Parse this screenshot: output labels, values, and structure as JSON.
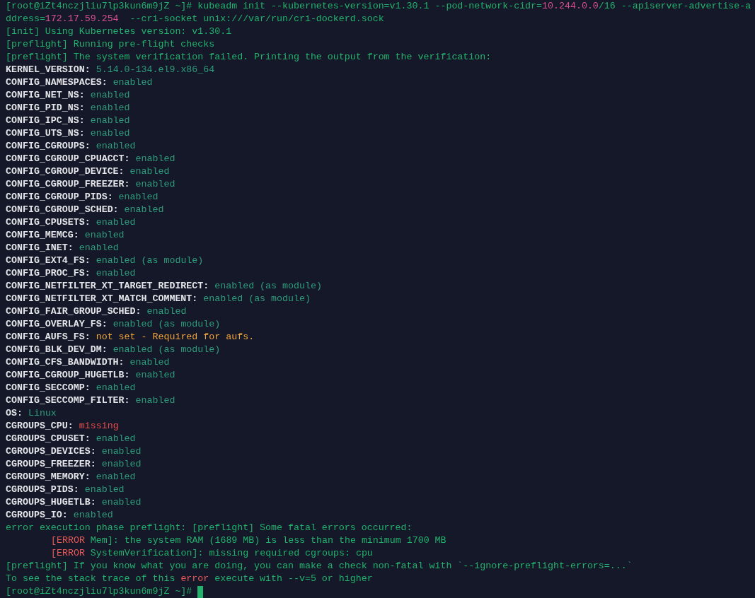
{
  "terminal": {
    "lines": [
      {
        "kind": "text",
        "segments": [
          {
            "kind": "plain",
            "text": "[root@iZt4nczjliu7lp3kun6m9jZ ~]# kubeadm init --kubernetes-version=v1.30.1 --pod-network-cidr="
          },
          {
            "kind": "number",
            "text": "10.244.0.0"
          },
          {
            "kind": "plain",
            "text": "/16 --apiserver-advertise-a"
          }
        ]
      },
      {
        "kind": "text",
        "segments": [
          {
            "kind": "plain",
            "text": "ddress="
          },
          {
            "kind": "number",
            "text": "172.17.59.254"
          },
          {
            "kind": "plain",
            "text": "  --cri-socket unix:///var/run/cri-dockerd.sock"
          }
        ]
      },
      {
        "kind": "text",
        "segments": [
          {
            "kind": "plain",
            "text": "[init] Using Kubernetes version: v1.30.1"
          }
        ]
      },
      {
        "kind": "text",
        "segments": [
          {
            "kind": "plain",
            "text": "[preflight] Running pre-flight checks"
          }
        ]
      },
      {
        "kind": "text",
        "segments": [
          {
            "kind": "plain",
            "text": "[preflight] The system verification failed. Printing the output from the verification:"
          }
        ]
      },
      {
        "kind": "check",
        "key": "KERNEL_VERSION:",
        "value": "5.14.0-134.el9.x86_64",
        "color": "#2e9c7c"
      },
      {
        "kind": "check",
        "key": "CONFIG_NAMESPACES:",
        "value": "enabled",
        "color": "#2e9c7c"
      },
      {
        "kind": "check",
        "key": "CONFIG_NET_NS:",
        "value": "enabled",
        "color": "#2e9c7c"
      },
      {
        "kind": "check",
        "key": "CONFIG_PID_NS:",
        "value": "enabled",
        "color": "#2e9c7c"
      },
      {
        "kind": "check",
        "key": "CONFIG_IPC_NS:",
        "value": "enabled",
        "color": "#2e9c7c"
      },
      {
        "kind": "check",
        "key": "CONFIG_UTS_NS:",
        "value": "enabled",
        "color": "#2e9c7c"
      },
      {
        "kind": "check",
        "key": "CONFIG_CGROUPS:",
        "value": "enabled",
        "color": "#2e9c7c"
      },
      {
        "kind": "check",
        "key": "CONFIG_CGROUP_CPUACCT:",
        "value": "enabled",
        "color": "#2e9c7c"
      },
      {
        "kind": "check",
        "key": "CONFIG_CGROUP_DEVICE:",
        "value": "enabled",
        "color": "#2e9c7c"
      },
      {
        "kind": "check",
        "key": "CONFIG_CGROUP_FREEZER:",
        "value": "enabled",
        "color": "#2e9c7c"
      },
      {
        "kind": "check",
        "key": "CONFIG_CGROUP_PIDS:",
        "value": "enabled",
        "color": "#2e9c7c"
      },
      {
        "kind": "check",
        "key": "CONFIG_CGROUP_SCHED:",
        "value": "enabled",
        "color": "#2e9c7c"
      },
      {
        "kind": "check",
        "key": "CONFIG_CPUSETS:",
        "value": "enabled",
        "color": "#2e9c7c"
      },
      {
        "kind": "check",
        "key": "CONFIG_MEMCG:",
        "value": "enabled",
        "color": "#2e9c7c"
      },
      {
        "kind": "check",
        "key": "CONFIG_INET:",
        "value": "enabled",
        "color": "#2e9c7c"
      },
      {
        "kind": "check",
        "key": "CONFIG_EXT4_FS:",
        "value": "enabled (as module)",
        "color": "#2e9c7c"
      },
      {
        "kind": "check",
        "key": "CONFIG_PROC_FS:",
        "value": "enabled",
        "color": "#2e9c7c"
      },
      {
        "kind": "check",
        "key": "CONFIG_NETFILTER_XT_TARGET_REDIRECT:",
        "value": "enabled (as module)",
        "color": "#2e9c7c"
      },
      {
        "kind": "check",
        "key": "CONFIG_NETFILTER_XT_MATCH_COMMENT:",
        "value": "enabled (as module)",
        "color": "#2e9c7c"
      },
      {
        "kind": "check",
        "key": "CONFIG_FAIR_GROUP_SCHED:",
        "value": "enabled",
        "color": "#2e9c7c"
      },
      {
        "kind": "check",
        "key": "CONFIG_OVERLAY_FS:",
        "value": "enabled (as module)",
        "color": "#2e9c7c"
      },
      {
        "kind": "check",
        "key": "CONFIG_AUFS_FS:",
        "value": "not set - Required for aufs.",
        "color": "#f2a33a"
      },
      {
        "kind": "check",
        "key": "CONFIG_BLK_DEV_DM:",
        "value": "enabled (as module)",
        "color": "#2e9c7c"
      },
      {
        "kind": "check",
        "key": "CONFIG_CFS_BANDWIDTH:",
        "value": "enabled",
        "color": "#2e9c7c"
      },
      {
        "kind": "check",
        "key": "CONFIG_CGROUP_HUGETLB:",
        "value": "enabled",
        "color": "#2e9c7c"
      },
      {
        "kind": "check",
        "key": "CONFIG_SECCOMP:",
        "value": "enabled",
        "color": "#2e9c7c"
      },
      {
        "kind": "check",
        "key": "CONFIG_SECCOMP_FILTER:",
        "value": "enabled",
        "color": "#2e9c7c"
      },
      {
        "kind": "check",
        "key": "OS:",
        "value": "Linux",
        "color": "#2e9c7c"
      },
      {
        "kind": "check",
        "key": "CGROUPS_CPU:",
        "value": "missing",
        "color": "#ea4a4a"
      },
      {
        "kind": "check",
        "key": "CGROUPS_CPUSET:",
        "value": "enabled",
        "color": "#2e9c7c"
      },
      {
        "kind": "check",
        "key": "CGROUPS_DEVICES:",
        "value": "enabled",
        "color": "#2e9c7c"
      },
      {
        "kind": "check",
        "key": "CGROUPS_FREEZER:",
        "value": "enabled",
        "color": "#2e9c7c"
      },
      {
        "kind": "check",
        "key": "CGROUPS_MEMORY:",
        "value": "enabled",
        "color": "#2e9c7c"
      },
      {
        "kind": "check",
        "key": "CGROUPS_PIDS:",
        "value": "enabled",
        "color": "#2e9c7c"
      },
      {
        "kind": "check",
        "key": "CGROUPS_HUGETLB:",
        "value": "enabled",
        "color": "#2e9c7c"
      },
      {
        "kind": "check",
        "key": "CGROUPS_IO:",
        "value": "enabled",
        "color": "#2e9c7c"
      },
      {
        "kind": "text",
        "segments": [
          {
            "kind": "plain",
            "text": "error execution phase preflight: [preflight] Some fatal errors occurred:"
          }
        ]
      },
      {
        "kind": "text",
        "indent": true,
        "segments": [
          {
            "kind": "error",
            "text": "[ERROR"
          },
          {
            "kind": "plain",
            "text": " Mem]: the system RAM (1689 MB) is less than the minimum 1700 MB"
          }
        ]
      },
      {
        "kind": "text",
        "indent": true,
        "segments": [
          {
            "kind": "error",
            "text": "[ERROR"
          },
          {
            "kind": "plain",
            "text": " SystemVerification]: missing required cgroups: cpu"
          }
        ]
      },
      {
        "kind": "text",
        "segments": [
          {
            "kind": "plain",
            "text": "[preflight] If you know what you are doing, you can make a check non-fatal with `--ignore-preflight-errors=...`"
          }
        ]
      },
      {
        "kind": "text",
        "segments": [
          {
            "kind": "plain",
            "text": "To see the stack trace of this "
          },
          {
            "kind": "error",
            "text": "error"
          },
          {
            "kind": "plain",
            "text": " execute with --v=5 or higher"
          }
        ]
      },
      {
        "kind": "prompt",
        "text": "[root@iZt4nczjliu7lp3kun6m9jZ ~]#"
      }
    ]
  }
}
